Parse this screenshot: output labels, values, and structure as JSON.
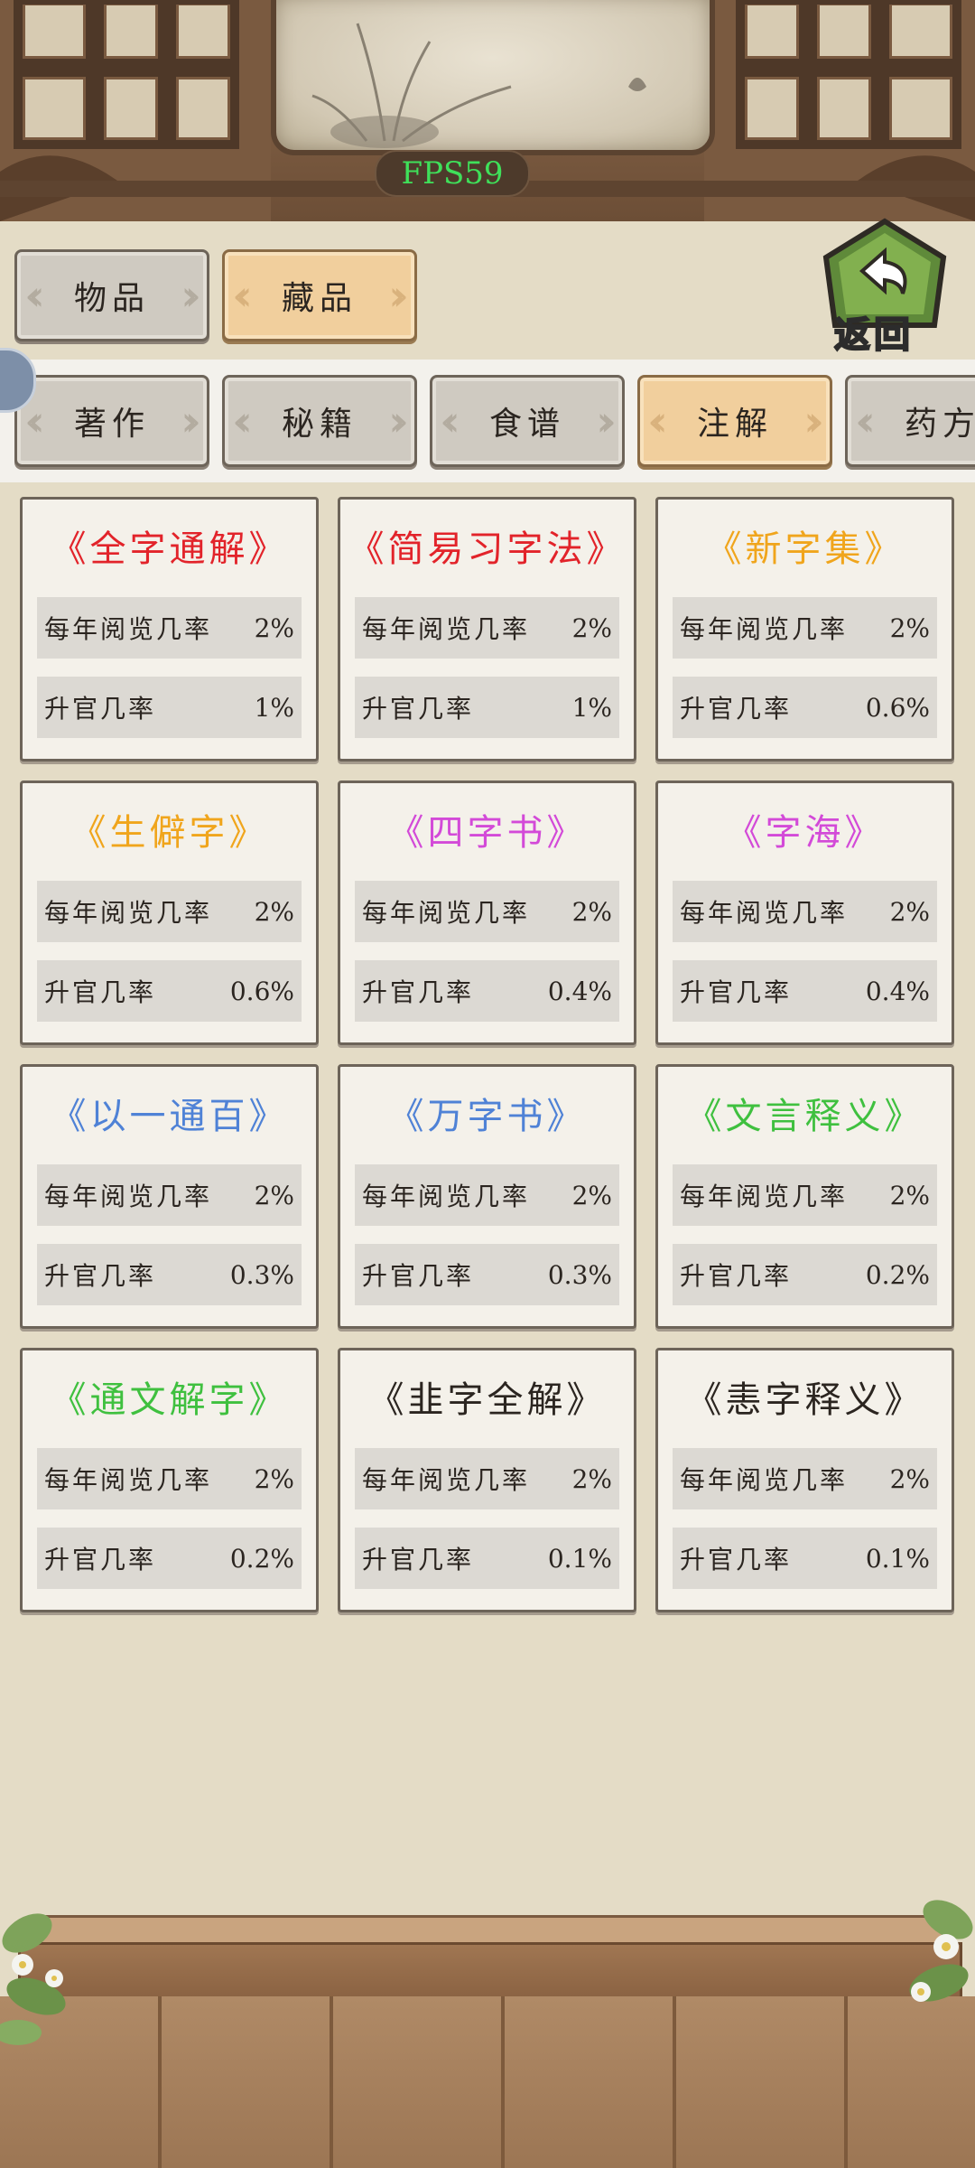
{
  "hud": {
    "fps": "FPS59"
  },
  "top_tabs": [
    {
      "label": "物品",
      "active": false
    },
    {
      "label": "藏品",
      "active": true
    }
  ],
  "back_button": {
    "label": "返回"
  },
  "sub_tabs": [
    {
      "label": "著作",
      "active": false
    },
    {
      "label": "秘籍",
      "active": false
    },
    {
      "label": "食谱",
      "active": false
    },
    {
      "label": "注解",
      "active": true
    },
    {
      "label": "药方",
      "active": false
    }
  ],
  "row_labels": {
    "read": "每年阅览几率",
    "promote": "升官几率"
  },
  "colors": {
    "red": "#e2232a",
    "orange": "#f0a51c",
    "magenta": "#d34ad8",
    "blue": "#4f82d6",
    "green": "#3fc03f",
    "black": "#2b2520"
  },
  "items": [
    {
      "title": "《全字通解》",
      "color": "#e2232a",
      "read": "2%",
      "promote": "1%"
    },
    {
      "title": "《简易习字法》",
      "color": "#e2232a",
      "read": "2%",
      "promote": "1%"
    },
    {
      "title": "《新字集》",
      "color": "#f0a51c",
      "read": "2%",
      "promote": "0.6%"
    },
    {
      "title": "《生僻字》",
      "color": "#f0a51c",
      "read": "2%",
      "promote": "0.6%"
    },
    {
      "title": "《四字书》",
      "color": "#d34ad8",
      "read": "2%",
      "promote": "0.4%"
    },
    {
      "title": "《字海》",
      "color": "#d34ad8",
      "read": "2%",
      "promote": "0.4%"
    },
    {
      "title": "《以一通百》",
      "color": "#4f82d6",
      "read": "2%",
      "promote": "0.3%"
    },
    {
      "title": "《万字书》",
      "color": "#4f82d6",
      "read": "2%",
      "promote": "0.3%"
    },
    {
      "title": "《文言释义》",
      "color": "#3fc03f",
      "read": "2%",
      "promote": "0.2%"
    },
    {
      "title": "《通文解字》",
      "color": "#3fc03f",
      "read": "2%",
      "promote": "0.2%"
    },
    {
      "title": "《韭字全解》",
      "color": "#2b2520",
      "read": "2%",
      "promote": "0.1%"
    },
    {
      "title": "《恚字释义》",
      "color": "#2b2520",
      "read": "2%",
      "promote": "0.1%"
    }
  ]
}
